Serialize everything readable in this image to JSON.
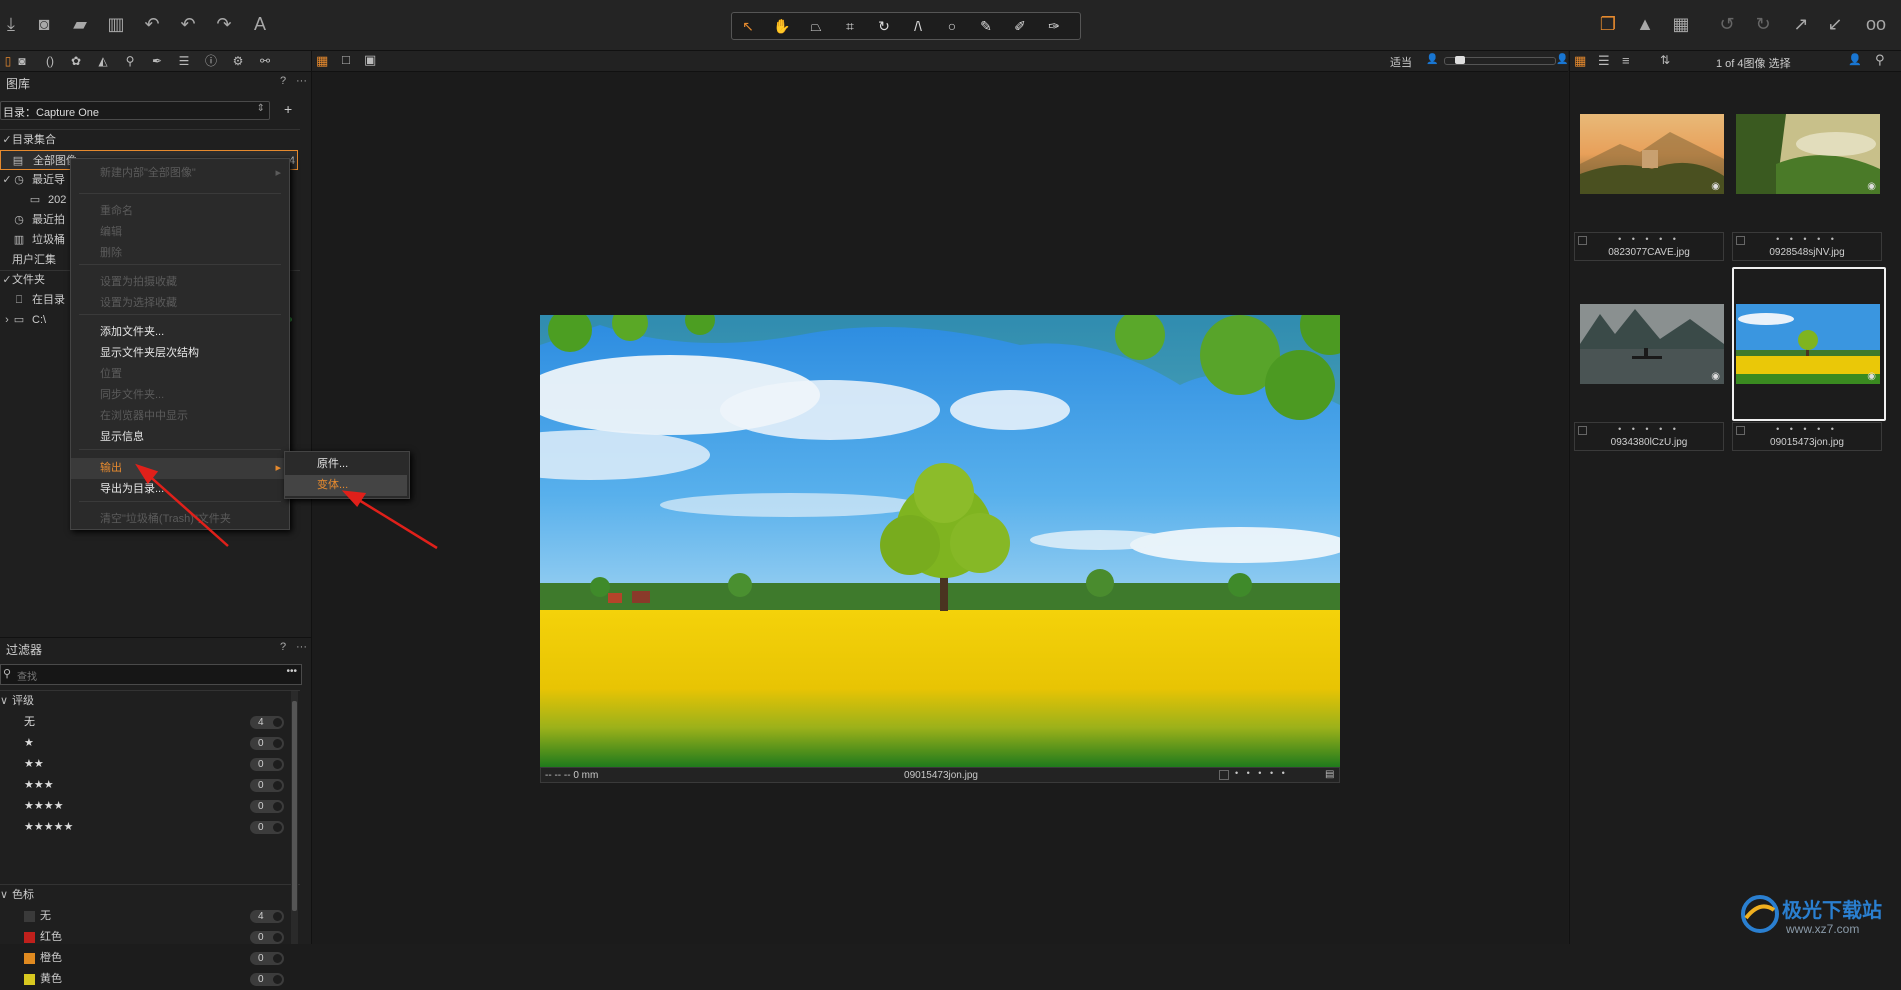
{
  "toolbar": {
    "left_icons": [
      "import-icon",
      "camera-icon",
      "folder-export-icon",
      "trash-icon",
      "undo-icon",
      "undo-step-icon",
      "redo-icon",
      "text-style-icon"
    ],
    "center_tools": [
      "cursor-icon",
      "pan-icon",
      "keystone-icon",
      "crop-icon",
      "rotate-icon",
      "straighten-icon",
      "circle-icon",
      "brush-icon",
      "eyedropper-icon",
      "eraser-icon"
    ],
    "right_icons": [
      "stack-icon",
      "warning-icon",
      "grid-icon",
      "rotate-left-icon",
      "rotate-right-icon",
      "export-icon",
      "import-arrow-icon",
      "glasses-icon"
    ]
  },
  "left_panel": {
    "library_title": "图库",
    "help": "?",
    "more": "···",
    "catalog_label": "目录：Capture One",
    "add": "+",
    "tree": {
      "section_catalog": "目录集合",
      "all_images": "全部图像",
      "all_count": "4",
      "recent_imports": "最近导",
      "recent_sub": "202",
      "recent_sub_count": "4",
      "recent_captures": "最近拍",
      "trash": "垃圾桶",
      "trash_count": "0",
      "user_collections": "用户汇集",
      "folders": "文件夹",
      "in_catalog": "在目录",
      "in_catalog_count": "0",
      "drive": "C:\\"
    },
    "filters": {
      "title": "过滤器",
      "search_placeholder": "查找",
      "rating_section": "评级",
      "ratings": [
        {
          "label": "无",
          "count": "4"
        },
        {
          "label": "★",
          "count": "0"
        },
        {
          "label": "★★",
          "count": "0"
        },
        {
          "label": "★★★",
          "count": "0"
        },
        {
          "label": "★★★★",
          "count": "0"
        },
        {
          "label": "★★★★★",
          "count": "0"
        }
      ],
      "color_section": "色标",
      "colors": [
        {
          "label": "无",
          "count": "4",
          "color": "#3a3a3a"
        },
        {
          "label": "红色",
          "count": "0",
          "color": "#c0201c"
        },
        {
          "label": "橙色",
          "count": "0",
          "color": "#e08a20"
        },
        {
          "label": "黄色",
          "count": "0",
          "color": "#d8c820"
        }
      ]
    }
  },
  "context_menu": {
    "items": [
      {
        "label": "新建内部\"全部图像\"",
        "disabled": true
      },
      {
        "label": "重命名",
        "disabled": true
      },
      {
        "label": "编辑",
        "disabled": true
      },
      {
        "label": "删除",
        "disabled": true
      },
      {
        "label": "设置为拍摄收藏",
        "disabled": true
      },
      {
        "label": "设置为选择收藏",
        "disabled": true
      },
      {
        "label": "添加文件夹...",
        "disabled": false
      },
      {
        "label": "显示文件夹层次结构",
        "disabled": false
      },
      {
        "label": "位置",
        "disabled": true
      },
      {
        "label": "同步文件夹...",
        "disabled": true
      },
      {
        "label": "在浏览器中中显示",
        "disabled": true
      },
      {
        "label": "显示信息",
        "disabled": false
      },
      {
        "label": "输出",
        "disabled": false,
        "highlighted": true
      },
      {
        "label": "导出为目录...",
        "disabled": false
      },
      {
        "label": "清空\"垃圾桶(Trash)\"文件夹",
        "disabled": true
      }
    ],
    "submenu": [
      {
        "label": "原件..."
      },
      {
        "label": "变体..."
      }
    ]
  },
  "viewer": {
    "fit_label": "适当",
    "caption": "09015473jon.jpg",
    "focal": "-- -- -- 0 mm",
    "rating_dots": "• • • • •"
  },
  "browser": {
    "count_label": "1 of 4图像 选择",
    "thumbnails": [
      {
        "name": "0823077CAVE.jpg",
        "dots": "• • • • •",
        "selected": false
      },
      {
        "name": "0928548sjNV.jpg",
        "dots": "• • • • •",
        "selected": false
      },
      {
        "name": "0934380lCzU.jpg",
        "dots": "• • • • •",
        "selected": false
      },
      {
        "name": "09015473jon.jpg",
        "dots": "• • • • •",
        "selected": true
      }
    ]
  },
  "watermark": {
    "brand": "极光下载站",
    "url": "www.xz7.com"
  },
  "colors": {
    "accent": "#e68a2e",
    "arrow": "#e0201a",
    "background": "#1c1c1c"
  }
}
